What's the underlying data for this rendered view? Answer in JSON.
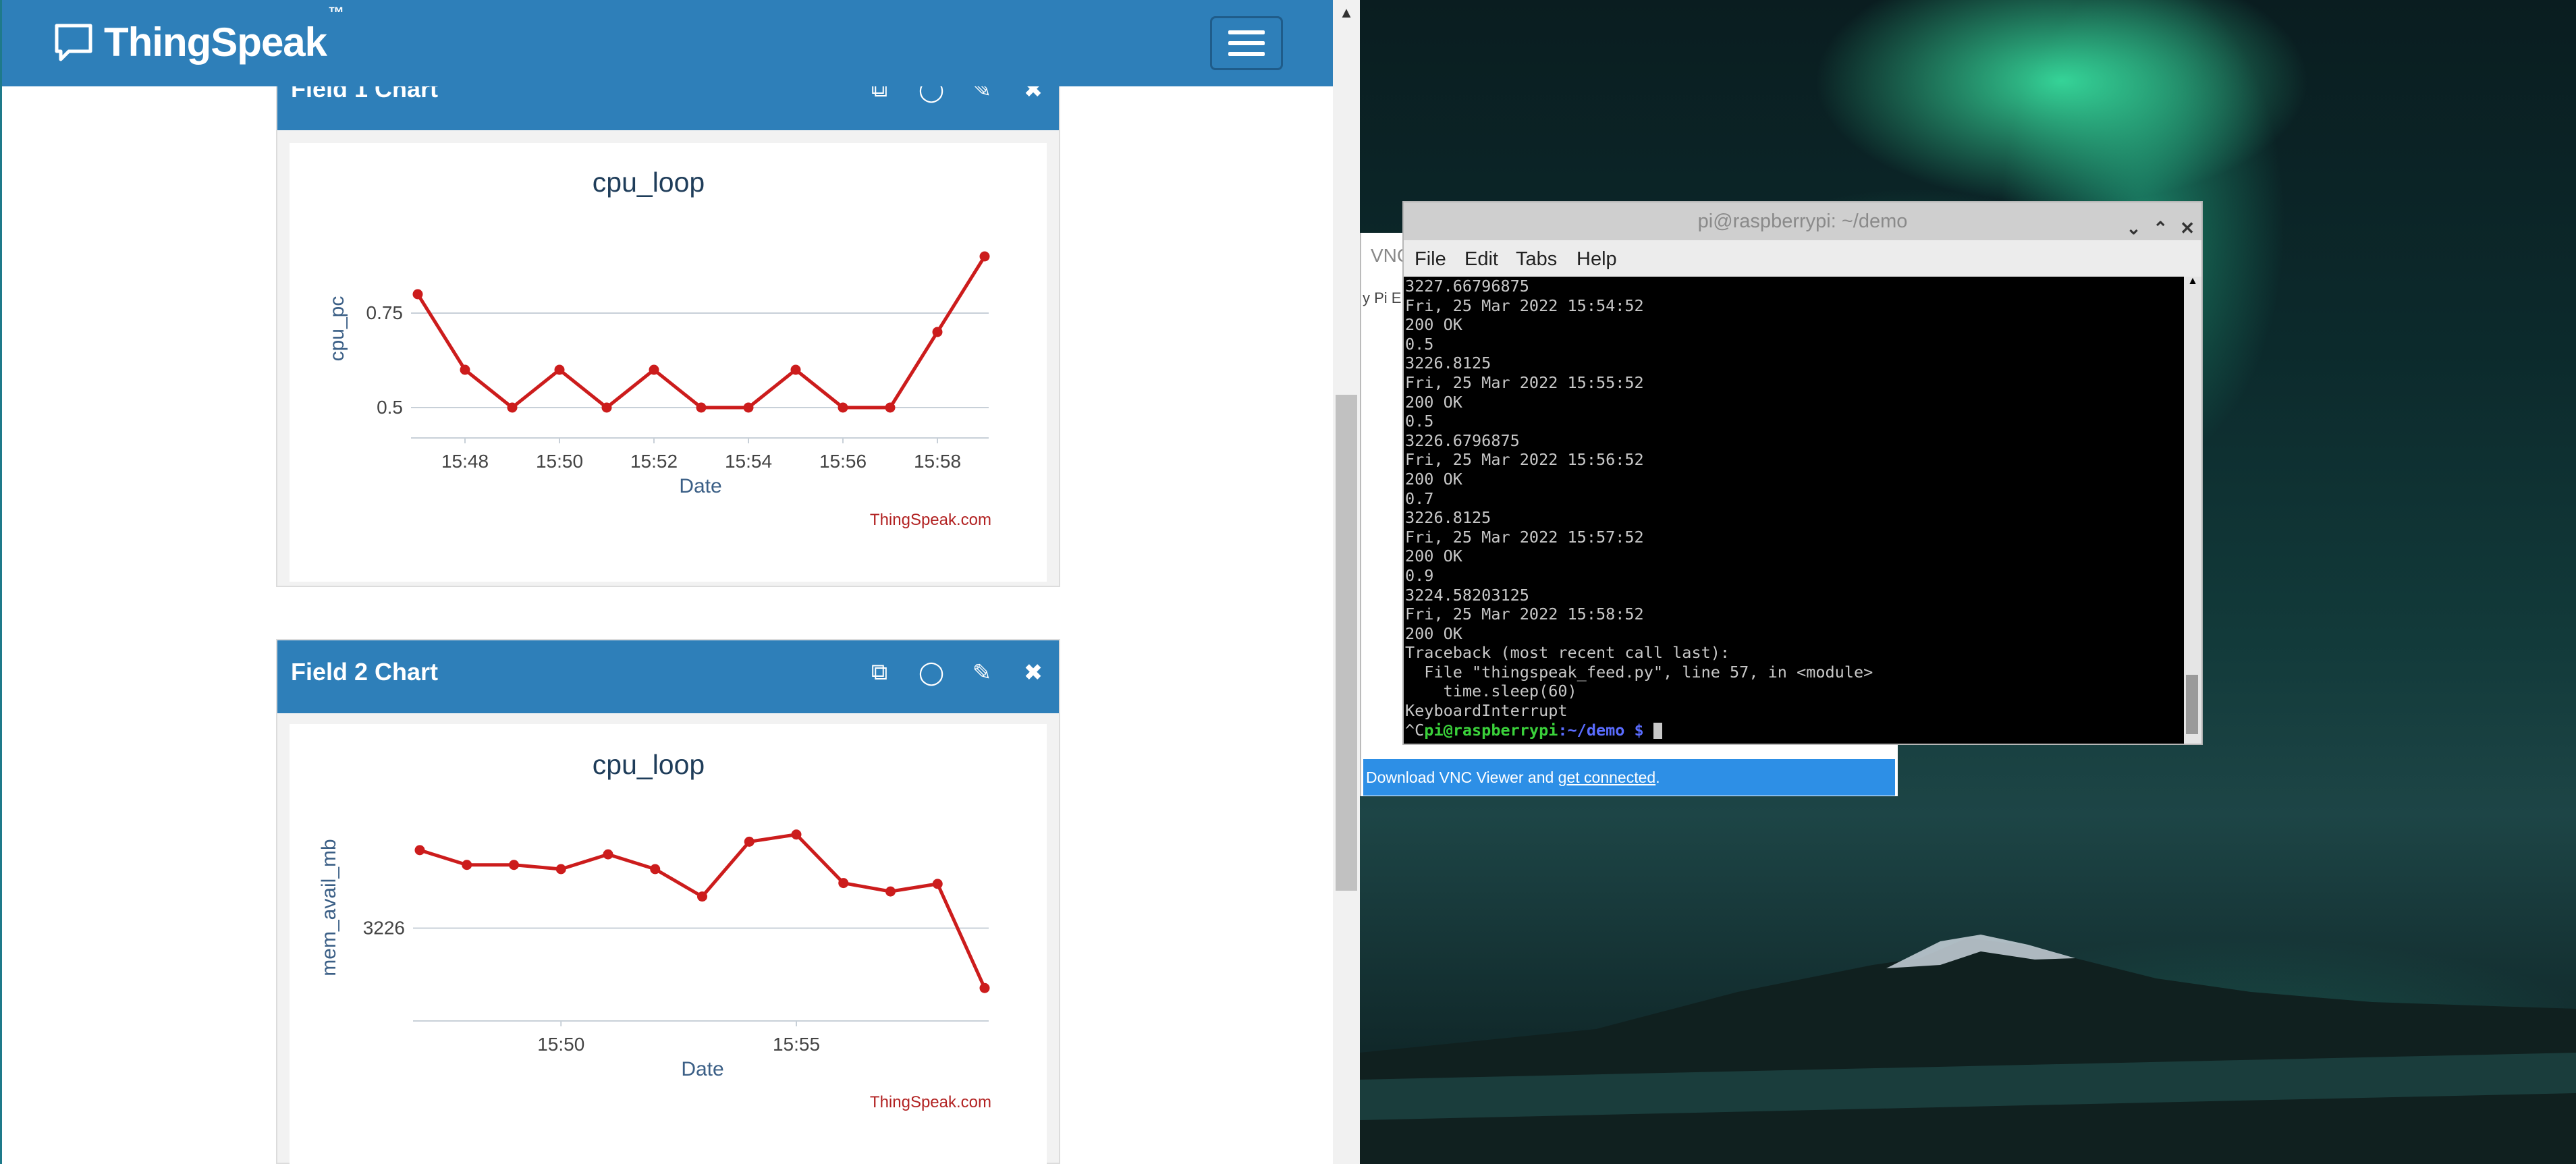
{
  "browser": {
    "brand": "ThingSpeak",
    "brand_tm": "™",
    "panels": [
      {
        "title": "Field 1 Chart",
        "icons": [
          "external-link-icon",
          "comment-icon",
          "pencil-icon",
          "close-icon"
        ],
        "watermark": "ThingSpeak.com"
      },
      {
        "title": "Field 2 Chart",
        "icons": [
          "external-link-icon",
          "comment-icon",
          "pencil-icon",
          "close-icon"
        ],
        "watermark": "ThingSpeak.com"
      }
    ]
  },
  "chart_data": [
    {
      "type": "line",
      "title": "cpu_loop",
      "xlabel": "Date",
      "ylabel": "cpu_pc",
      "x_ticks": [
        "15:48",
        "15:50",
        "15:52",
        "15:54",
        "15:56",
        "15:58"
      ],
      "y_ticks": [
        "0.5",
        "0.75"
      ],
      "ylim": [
        0.45,
        0.95
      ],
      "x": [
        "15:47",
        "15:48",
        "15:49",
        "15:50",
        "15:51",
        "15:52",
        "15:53",
        "15:54",
        "15:55",
        "15:56",
        "15:57",
        "15:58",
        "15:59"
      ],
      "y": [
        0.8,
        0.6,
        0.5,
        0.6,
        0.5,
        0.6,
        0.5,
        0.5,
        0.6,
        0.5,
        0.5,
        0.7,
        0.9
      ],
      "color": "#cc1c1c",
      "grid": true
    },
    {
      "type": "line",
      "title": "cpu_loop",
      "xlabel": "Date",
      "ylabel": "mem_avail_mb",
      "x_ticks": [
        "15:50",
        "15:55"
      ],
      "y_ticks": [
        "3226"
      ],
      "ylim": [
        3223.8,
        3228.6
      ],
      "x": [
        "15:47",
        "15:48",
        "15:49",
        "15:50",
        "15:51",
        "15:52",
        "15:53",
        "15:54",
        "15:55",
        "15:56",
        "15:57",
        "15:58",
        "15:59"
      ],
      "y": [
        3227.85,
        3227.5,
        3227.5,
        3227.4,
        3227.75,
        3227.4,
        3226.75,
        3228.05,
        3228.22,
        3227.07,
        3226.87,
        3227.05,
        3224.58
      ],
      "color": "#cc1c1c",
      "grid": true
    }
  ],
  "terminal": {
    "title": "pi@raspberrypi: ~/demo",
    "menu": [
      "File",
      "Edit",
      "Tabs",
      "Help"
    ],
    "behind_label": "VNC",
    "behind_label2": "y Pi E",
    "lines": [
      "3227.66796875",
      "Fri, 25 Mar 2022 15:54:52",
      "200 OK",
      "0.5",
      "3226.8125",
      "Fri, 25 Mar 2022 15:55:52",
      "200 OK",
      "0.5",
      "3226.6796875",
      "Fri, 25 Mar 2022 15:56:52",
      "200 OK",
      "0.7",
      "3226.8125",
      "Fri, 25 Mar 2022 15:57:52",
      "200 OK",
      "0.9",
      "3224.58203125",
      "Fri, 25 Mar 2022 15:58:52",
      "200 OK",
      "Traceback (most recent call last):",
      "  File \"thingspeak_feed.py\", line 57, in <module>",
      "    time.sleep(60)",
      "KeyboardInterrupt"
    ],
    "prompt_prefix": "^C",
    "prompt_user": "pi@raspberrypi",
    "prompt_path": ":~/demo $ "
  },
  "vnc_banner": {
    "text": "Download VNC Viewer and ",
    "link": "get connected",
    "suffix": "."
  }
}
